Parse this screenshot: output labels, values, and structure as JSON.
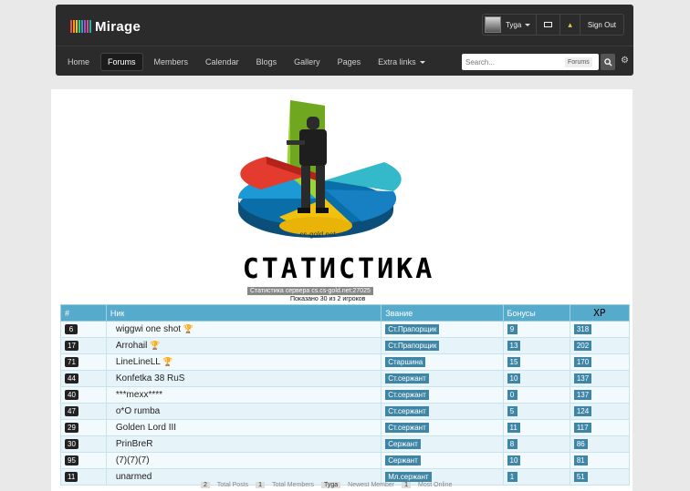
{
  "brand": {
    "name": "Mirage",
    "bar_colors": [
      "#e94e4e",
      "#f39c12",
      "#f1c40f",
      "#2ecc71",
      "#3498db",
      "#9b59b6",
      "#e84393",
      "#1abc9c"
    ]
  },
  "user": {
    "name": "Tyga",
    "sign_out": "Sign Out"
  },
  "nav": [
    {
      "label": "Home",
      "active": false
    },
    {
      "label": "Forums",
      "active": true
    },
    {
      "label": "Members",
      "active": false
    },
    {
      "label": "Calendar",
      "active": false
    },
    {
      "label": "Blogs",
      "active": false
    },
    {
      "label": "Gallery",
      "active": false
    },
    {
      "label": "Pages",
      "active": false
    },
    {
      "label": "Extra links",
      "active": false
    }
  ],
  "search": {
    "placeholder": "Search...",
    "scope": "Forums"
  },
  "banner": {
    "logo_caption": "cs-gold.net",
    "title": "СТАТИСТИКА",
    "subtitle": "Статистика сервера cs.cs-gold.net:27025",
    "shown": "Показано 30 из 2 игроков"
  },
  "table": {
    "headers": {
      "num": "#",
      "nick": "Ник",
      "rank": "Звание",
      "bonus": "Бонусы",
      "xp": "XP"
    },
    "rows": [
      {
        "num": "6",
        "nick": "wiggwi one shot",
        "trophy": "gold",
        "rank": "Ст.Прапорщик",
        "bonus": "9",
        "xp": "318"
      },
      {
        "num": "17",
        "nick": "Arrohail",
        "trophy": "grey",
        "rank": "Ст.Прапорщик",
        "bonus": "13",
        "xp": "202"
      },
      {
        "num": "71",
        "nick": "LineLineLL",
        "trophy": "gold",
        "rank": "Старшина",
        "bonus": "15",
        "xp": "170"
      },
      {
        "num": "44",
        "nick": "Konfetka 38 RuS",
        "trophy": "",
        "rank": "Ст.сержант",
        "bonus": "10",
        "xp": "137"
      },
      {
        "num": "40",
        "nick": "***mexx****",
        "trophy": "",
        "rank": "Ст.сержант",
        "bonus": "0",
        "xp": "137"
      },
      {
        "num": "47",
        "nick": "o*O rumba",
        "trophy": "",
        "rank": "Ст.сержант",
        "bonus": "5",
        "xp": "124"
      },
      {
        "num": "29",
        "nick": "Golden Lord III",
        "trophy": "",
        "rank": "Ст.сержант",
        "bonus": "11",
        "xp": "117"
      },
      {
        "num": "30",
        "nick": "PrinBreR",
        "trophy": "",
        "rank": "Сержант",
        "bonus": "8",
        "xp": "86"
      },
      {
        "num": "95",
        "nick": "(7)(7)(7)",
        "trophy": "",
        "rank": "Сержант",
        "bonus": "10",
        "xp": "81"
      },
      {
        "num": "11",
        "nick": "unarmed",
        "trophy": "",
        "rank": "Мл.сержант",
        "bonus": "1",
        "xp": "51"
      }
    ]
  },
  "footer": {
    "total_posts_value": "2",
    "total_posts_label": "Total Posts",
    "total_members_value": "1",
    "total_members_label": "Total Members",
    "newest_member_value": "Tyga",
    "newest_member_label": "Newest Member",
    "online_value": "1",
    "online_label": "Most Online"
  }
}
